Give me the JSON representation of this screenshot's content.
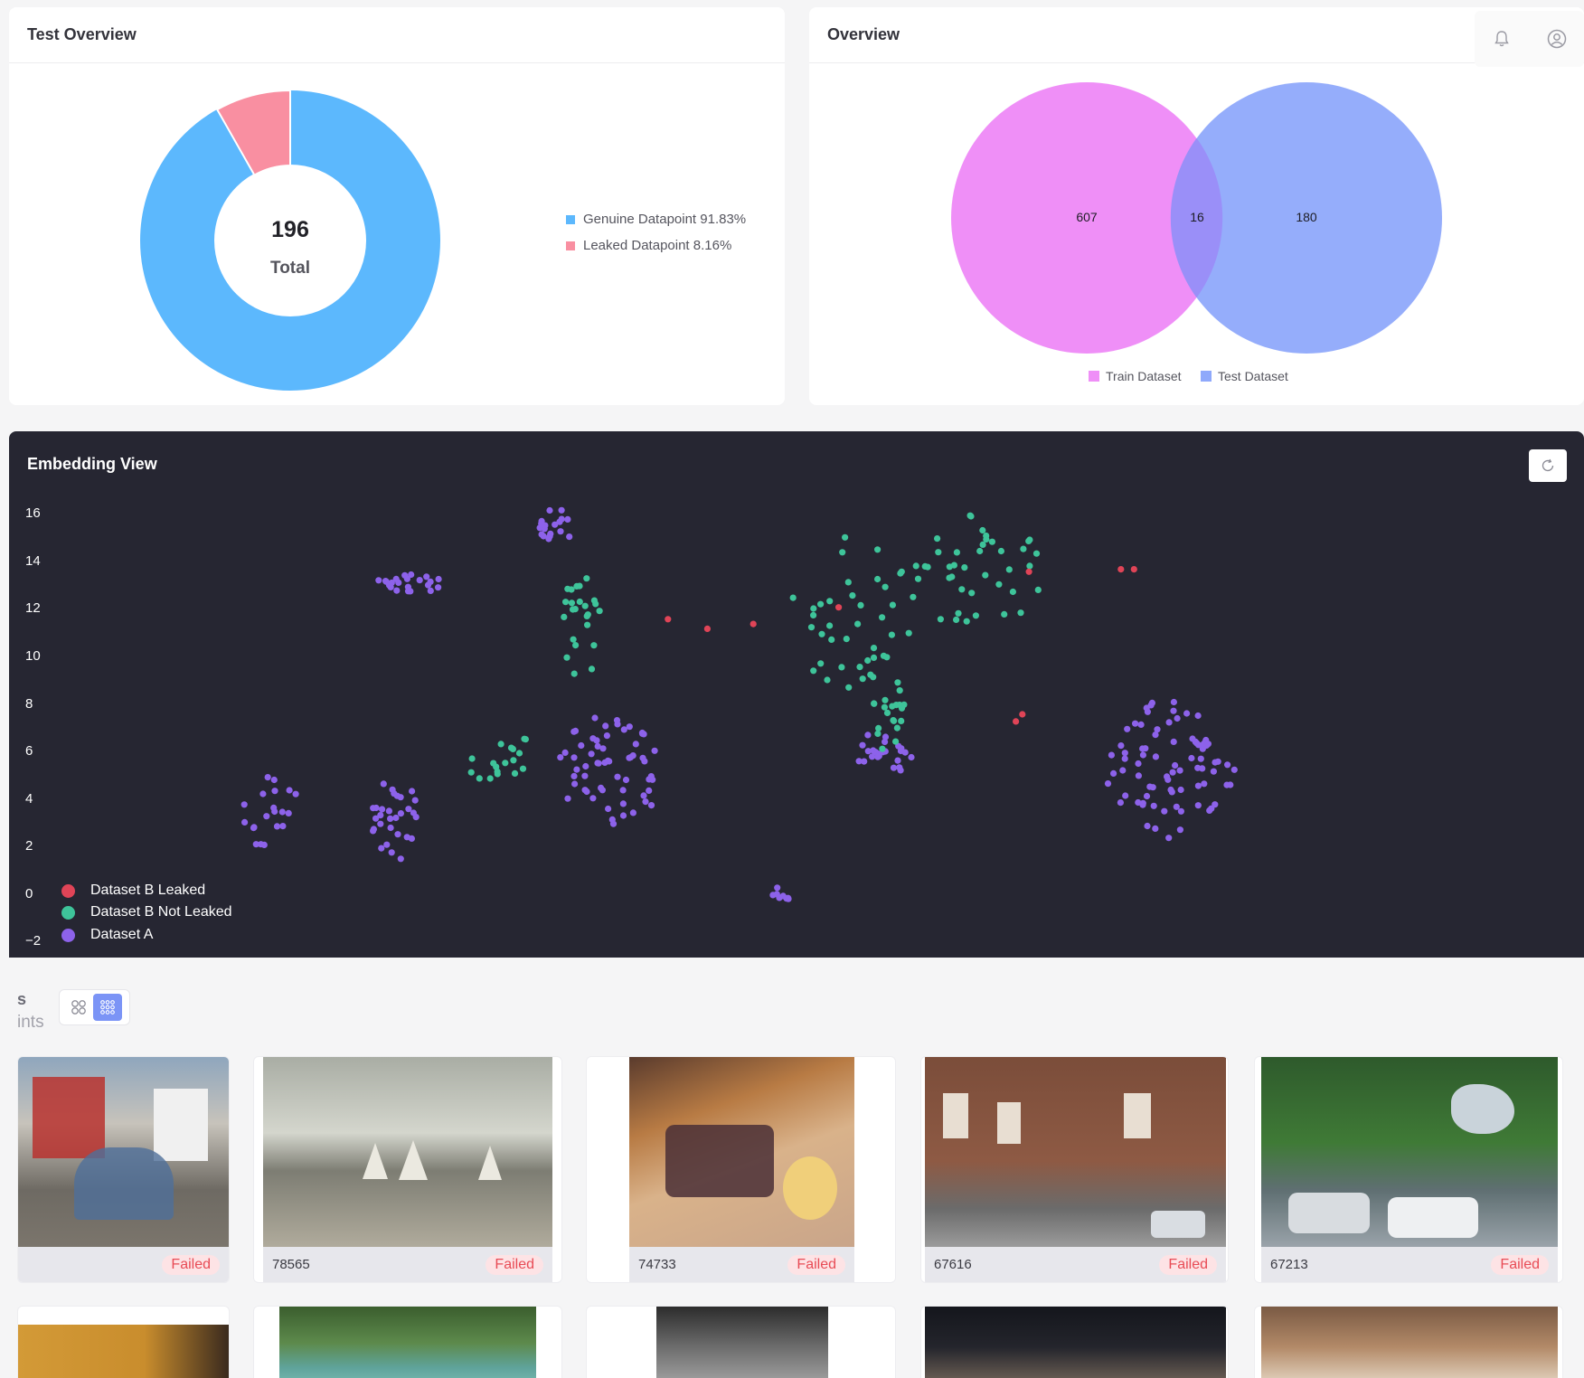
{
  "test_overview": {
    "title": "Test Overview",
    "total_value": "196",
    "total_label": "Total",
    "legend": [
      {
        "label": "Genuine Datapoint 91.83%",
        "color": "#5cb8fd"
      },
      {
        "label": "Leaked Datapoint 8.16%",
        "color": "#f98fa1"
      }
    ]
  },
  "overview": {
    "title": "Overview",
    "train_only": "607",
    "intersection": "16",
    "test_only": "180",
    "legend": [
      {
        "label": "Train Dataset",
        "color": "#ef8ff7"
      },
      {
        "label": "Test Dataset",
        "color": "#8fa9fb"
      }
    ]
  },
  "topbar": {
    "icons": [
      "bell-icon",
      "user-circle-icon"
    ]
  },
  "embedding": {
    "title": "Embedding View",
    "y_ticks": [
      "16",
      "14",
      "12",
      "10",
      "8",
      "6",
      "4",
      "2",
      "0",
      "−2"
    ],
    "legend": [
      {
        "label": "Dataset B Leaked",
        "color": "#e04457"
      },
      {
        "label": "Dataset B Not Leaked",
        "color": "#3ec49a"
      },
      {
        "label": "Dataset A",
        "color": "#8d62ea"
      }
    ]
  },
  "chart_data": [
    {
      "type": "pie",
      "categories": [
        "Genuine Datapoint",
        "Leaked Datapoint"
      ],
      "values": [
        91.83,
        8.16
      ],
      "center_text": "196 Total"
    },
    {
      "type": "scatter",
      "title": "Embedding View",
      "ylim": [
        -2,
        17
      ],
      "series": [
        {
          "name": "Dataset A",
          "clusters": [
            [
              14.3,
              15.2,
              0.9,
              0.3,
              18
            ],
            [
              12.0,
              10.8,
              0.4,
              0.6,
              22
            ],
            [
              2.3,
              6.6,
              1.6,
              0.5,
              20
            ],
            [
              2.1,
              10.4,
              1.8,
              0.4,
              30
            ],
            [
              4.2,
              17.0,
              2.4,
              0.9,
              60
            ],
            [
              4.9,
              25.3,
              0.9,
              0.5,
              24
            ],
            [
              4.1,
              34.0,
              3.0,
              1.1,
              80
            ],
            [
              -1.0,
              22.2,
              0.3,
              0.2,
              8
            ]
          ]
        },
        {
          "name": "Dataset B Not Leaked",
          "clusters": [
            [
              10.3,
              16.0,
              2.3,
              0.4,
              24
            ],
            [
              4.3,
              13.4,
              0.6,
              0.5,
              12
            ],
            [
              5.2,
              14.0,
              0.4,
              0.3,
              6
            ],
            [
              6.3,
              25.6,
              1.6,
              0.4,
              20
            ],
            [
              10.8,
              24.4,
              3.3,
              1.1,
              40
            ],
            [
              12.4,
              28.2,
              2.5,
              1.1,
              40
            ]
          ]
        },
        {
          "name": "Dataset B Leaked",
          "points": [
            [
              10.5,
              18.7
            ],
            [
              10.1,
              19.9
            ],
            [
              10.3,
              21.3
            ],
            [
              11.0,
              23.9
            ],
            [
              6.2,
              29.3
            ],
            [
              6.5,
              29.5
            ],
            [
              12.5,
              29.7
            ],
            [
              12.6,
              32.5
            ],
            [
              12.6,
              32.9
            ]
          ]
        }
      ]
    }
  ],
  "gallery": {
    "title": "s",
    "subtitle": "ints",
    "tiles": [
      {
        "id": "",
        "status": "Failed"
      },
      {
        "id": "78565",
        "status": "Failed"
      },
      {
        "id": "74733",
        "status": "Failed"
      },
      {
        "id": "67616",
        "status": "Failed"
      },
      {
        "id": "67213",
        "status": "Failed"
      }
    ]
  }
}
